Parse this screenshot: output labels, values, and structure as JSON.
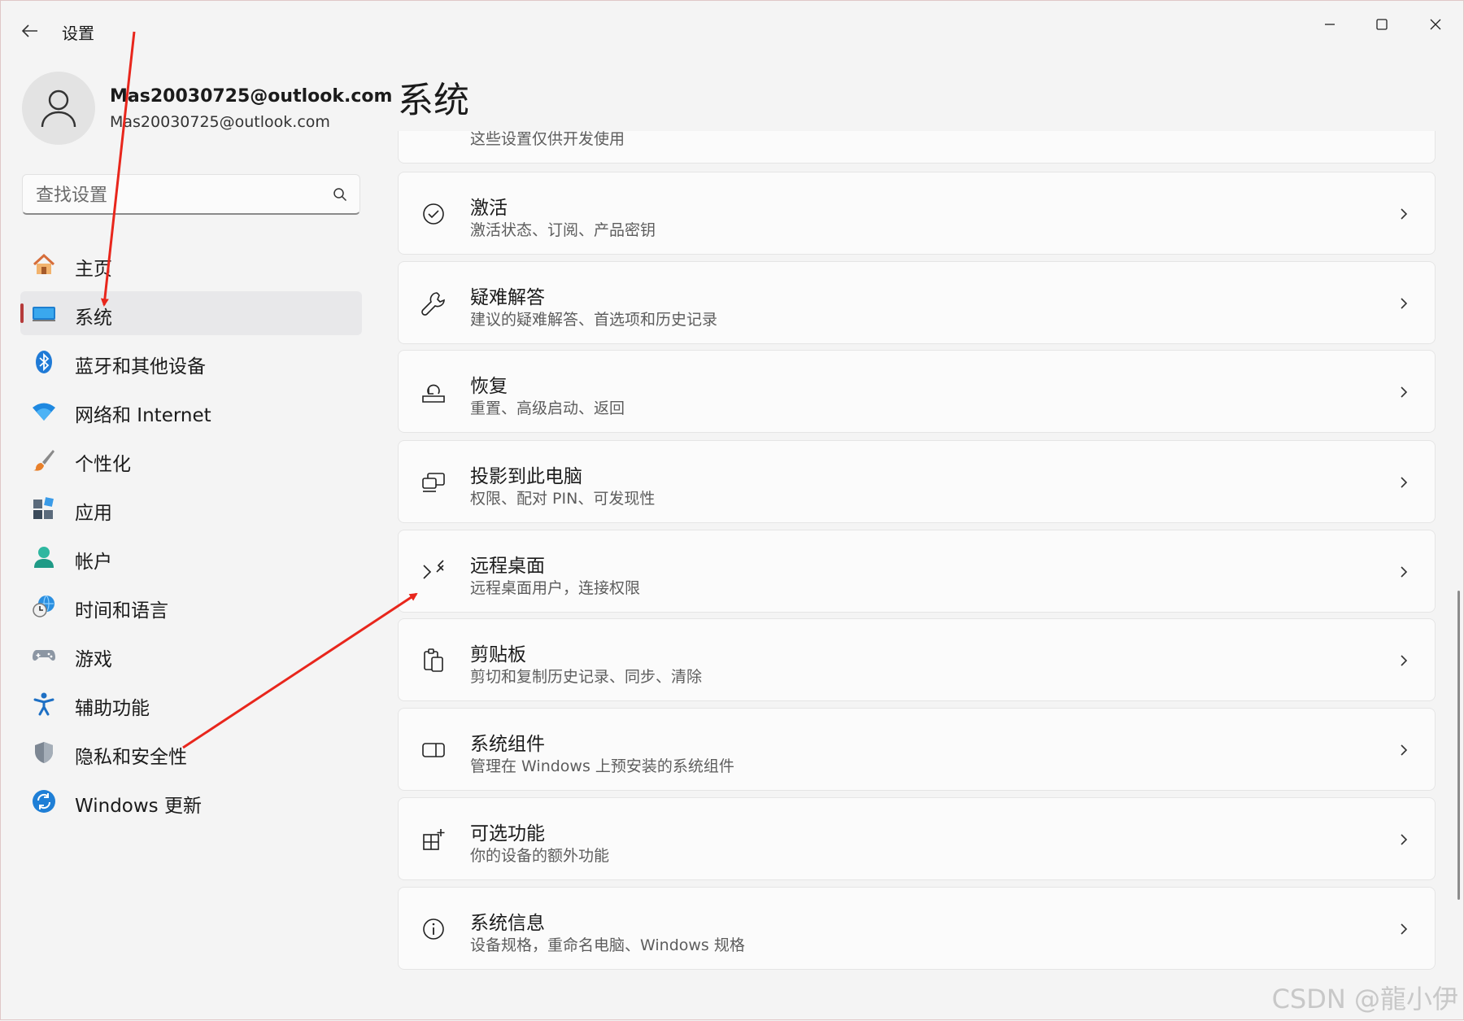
{
  "window": {
    "title": "设置",
    "controls": [
      "minimize",
      "maximize",
      "close"
    ]
  },
  "profile": {
    "name": "Mas20030725@outlook.com",
    "email": "Mas20030725@outlook.com"
  },
  "search": {
    "placeholder": "查找设置"
  },
  "sidebar": {
    "items": [
      {
        "label": "主页",
        "icon": "home-icon"
      },
      {
        "label": "系统",
        "icon": "system-icon",
        "active": true
      },
      {
        "label": "蓝牙和其他设备",
        "icon": "bluetooth-icon"
      },
      {
        "label": "网络和 Internet",
        "icon": "wifi-icon"
      },
      {
        "label": "个性化",
        "icon": "brush-icon"
      },
      {
        "label": "应用",
        "icon": "apps-icon"
      },
      {
        "label": "帐户",
        "icon": "account-icon"
      },
      {
        "label": "时间和语言",
        "icon": "time-language-icon"
      },
      {
        "label": "游戏",
        "icon": "gamepad-icon"
      },
      {
        "label": "辅助功能",
        "icon": "accessibility-icon"
      },
      {
        "label": "隐私和安全性",
        "icon": "shield-icon"
      },
      {
        "label": "Windows 更新",
        "icon": "update-icon"
      }
    ]
  },
  "main": {
    "title": "系统",
    "cards": [
      {
        "title": "",
        "subtitle": "这些设置仅供开发使用",
        "icon": "developer-icon"
      },
      {
        "title": "激活",
        "subtitle": "激活状态、订阅、产品密钥",
        "icon": "check-circle-icon"
      },
      {
        "title": "疑难解答",
        "subtitle": "建议的疑难解答、首选项和历史记录",
        "icon": "wrench-icon"
      },
      {
        "title": "恢复",
        "subtitle": "重置、高级启动、返回",
        "icon": "recovery-icon"
      },
      {
        "title": "投影到此电脑",
        "subtitle": "权限、配对 PIN、可发现性",
        "icon": "project-icon"
      },
      {
        "title": "远程桌面",
        "subtitle": "远程桌面用户，连接权限",
        "icon": "remote-desktop-icon"
      },
      {
        "title": "剪贴板",
        "subtitle": "剪切和复制历史记录、同步、清除",
        "icon": "clipboard-icon"
      },
      {
        "title": "系统组件",
        "subtitle": "管理在 Windows 上预安装的系统组件",
        "icon": "components-icon"
      },
      {
        "title": "可选功能",
        "subtitle": "你的设备的额外功能",
        "icon": "optional-features-icon"
      },
      {
        "title": "系统信息",
        "subtitle": "设备规格，重命名电脑、Windows 规格",
        "icon": "info-icon"
      }
    ]
  },
  "watermark": "CSDN @龍小伊",
  "colors": {
    "active_indicator": "#b53a3a",
    "annotation_arrow": "#e8261c"
  }
}
